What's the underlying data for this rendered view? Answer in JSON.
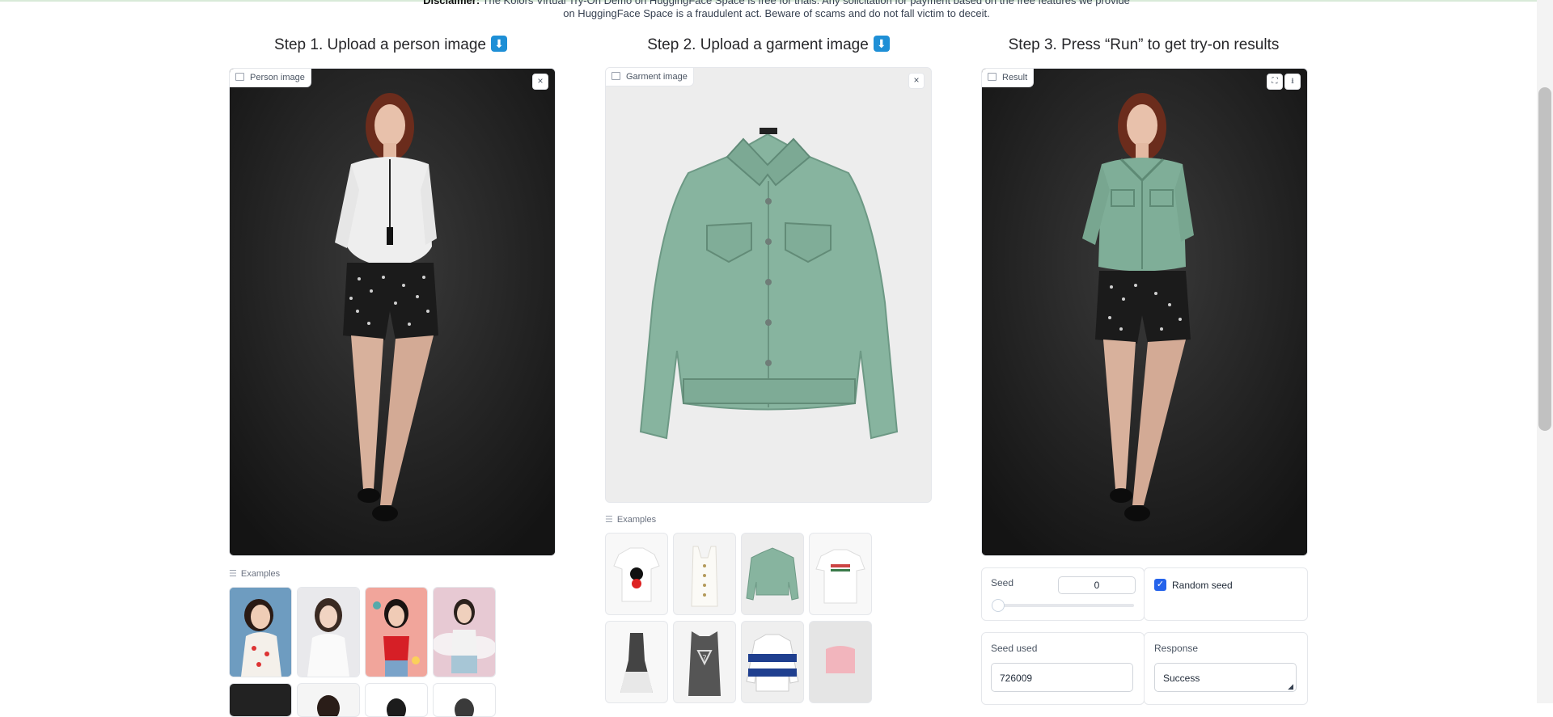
{
  "disclaimer": {
    "line1_bold": "Disclaimer:",
    "line1_rest": " The Kolors Virtual Try-On Demo on HuggingFace Space is free for trials. Any solicitation for payment based on the free features we provide",
    "line2": "on HuggingFace Space is a fraudulent act. Beware of scams and do not fall victim to deceit."
  },
  "step1": {
    "title": "Step 1. Upload a person image",
    "badge": "⬇",
    "panel_label": "Person image",
    "clear_icon": "×",
    "examples_label": "Examples"
  },
  "step2": {
    "title": "Step 2. Upload a garment image",
    "badge": "⬇",
    "panel_label": "Garment image",
    "clear_icon": "×",
    "examples_label": "Examples"
  },
  "step3": {
    "title": "Step 3. Press “Run” to get try-on results",
    "panel_label": "Result",
    "fullscreen_icon": "⛶",
    "download_icon": "⭳"
  },
  "seed": {
    "label": "Seed",
    "value": "0",
    "slider_fraction": 0
  },
  "random_seed": {
    "label": "Random seed",
    "checked": true
  },
  "seed_used": {
    "label": "Seed used",
    "value": "726009"
  },
  "response": {
    "label": "Response",
    "value": "Success"
  },
  "icons": {
    "list": "list-icon",
    "image": "image-icon",
    "close": "close-icon",
    "fullscreen": "fullscreen-icon",
    "download": "download-icon",
    "checkbox": "checkbox-icon"
  },
  "colors": {
    "accent": "#1e8fd6",
    "checkbox": "#2563eb",
    "jacket": "#86b5a0"
  }
}
